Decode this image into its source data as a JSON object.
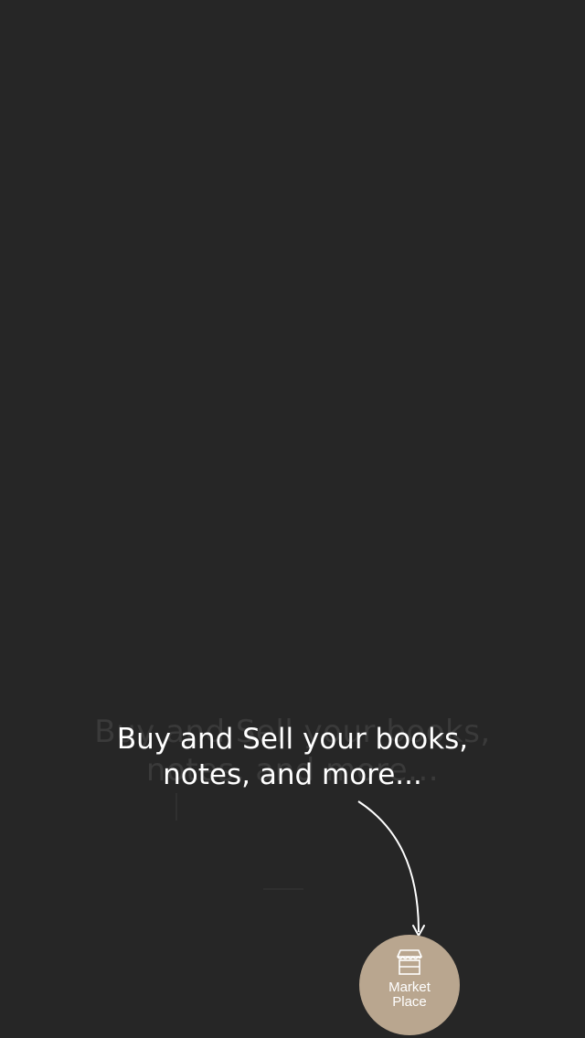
{
  "background_color": "#262626",
  "accent_color": "#b9a68f",
  "ghost_content": {
    "line1": "Buy and Sell your books,",
    "line2": "notes, and more..."
  },
  "coach_mark": {
    "line1": "Buy and Sell your books,",
    "line2": "notes, and more...",
    "pointer_icon": "curved-arrow-icon"
  },
  "market_button": {
    "icon": "storefront-icon",
    "label_line1": "Market",
    "label_line2": "Place"
  }
}
